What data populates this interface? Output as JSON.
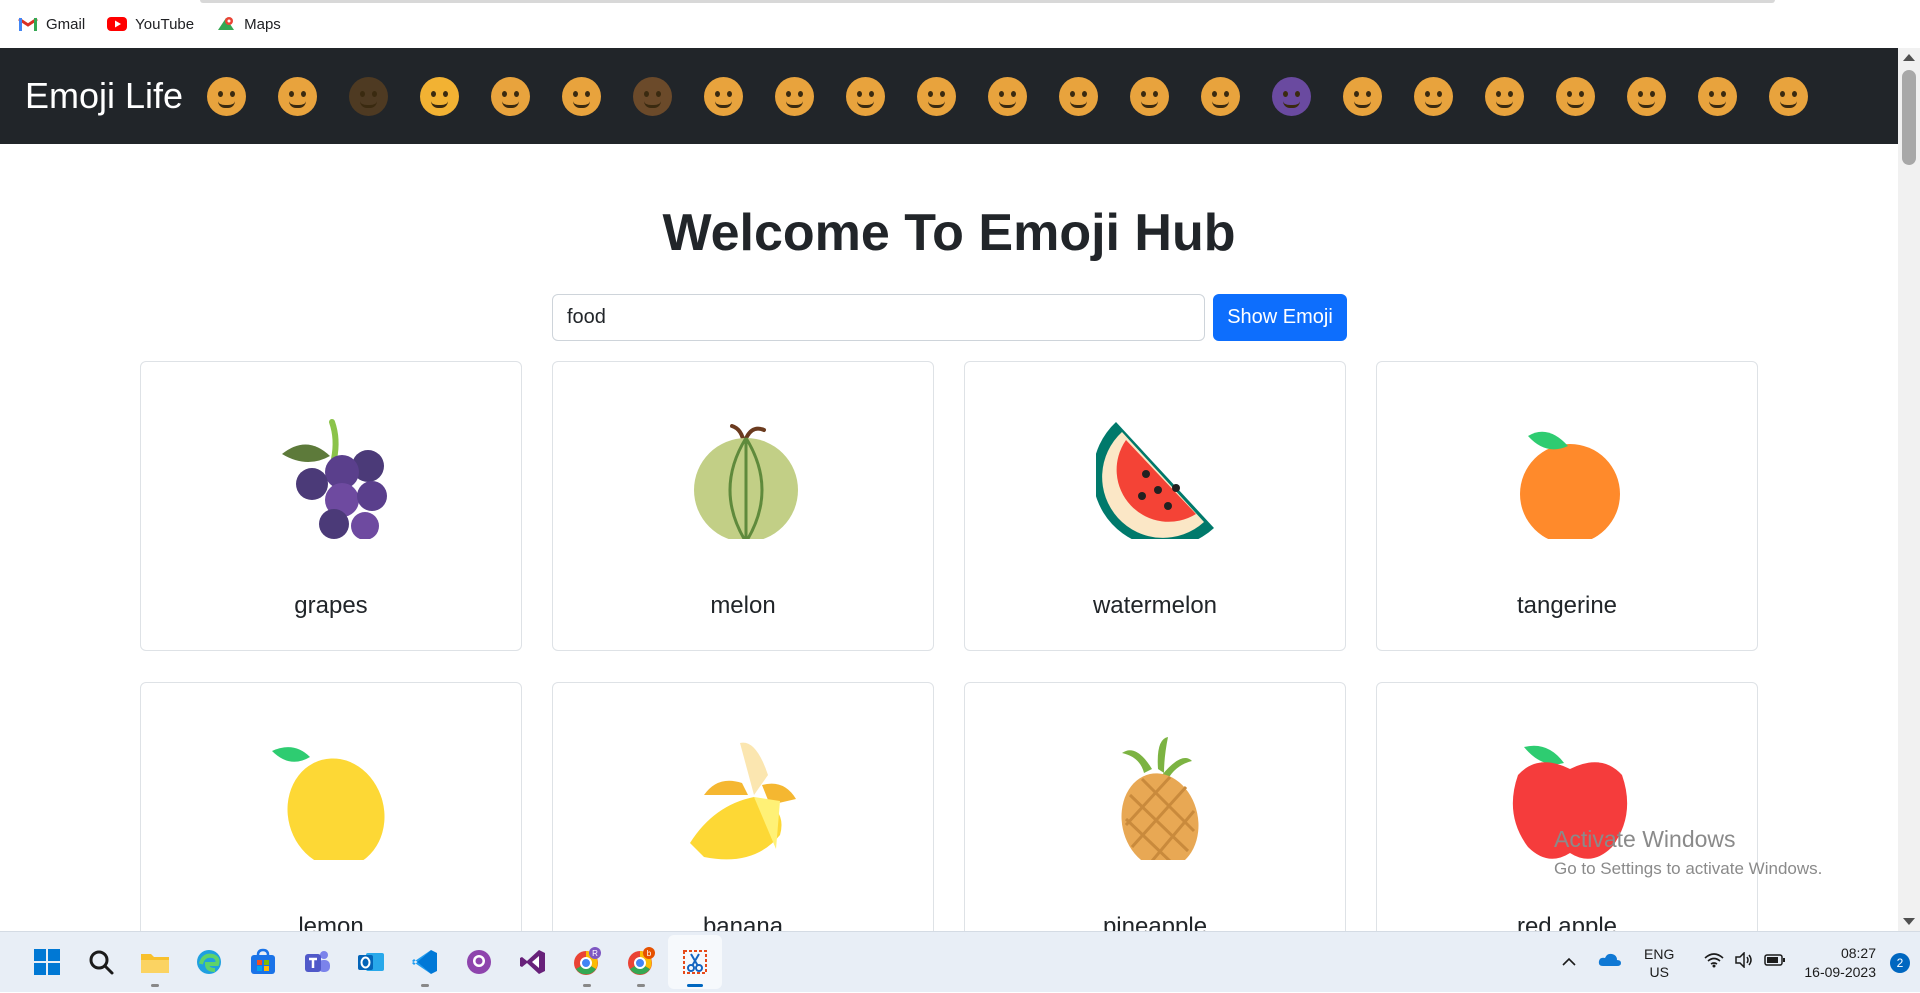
{
  "bookmarks": [
    {
      "label": "Gmail",
      "icon": "gmail-icon"
    },
    {
      "label": "YouTube",
      "icon": "youtube-icon"
    },
    {
      "label": "Maps",
      "icon": "maps-icon"
    }
  ],
  "navbar": {
    "brand": "Emoji Life",
    "emoji_count": 23
  },
  "main": {
    "heading": "Welcome To Emoji Hub",
    "search": {
      "value": "food",
      "button_label": "Show Emoji"
    },
    "cards": [
      {
        "label": "grapes",
        "icon": "grapes-icon"
      },
      {
        "label": "melon",
        "icon": "melon-icon"
      },
      {
        "label": "watermelon",
        "icon": "watermelon-icon"
      },
      {
        "label": "tangerine",
        "icon": "tangerine-icon"
      },
      {
        "label": "lemon",
        "icon": "lemon-icon"
      },
      {
        "label": "banana",
        "icon": "banana-icon"
      },
      {
        "label": "pineapple",
        "icon": "pineapple-icon"
      },
      {
        "label": "red apple",
        "icon": "red-apple-icon"
      }
    ]
  },
  "watermark": {
    "line1": "Activate Windows",
    "line2": "Go to Settings to activate Windows."
  },
  "taskbar": {
    "apps": [
      "start-icon",
      "search-icon",
      "file-explorer-icon",
      "edge-icon",
      "store-icon",
      "teams-icon",
      "outlook-icon",
      "vscode-icon",
      "github-icon",
      "visual-studio-icon",
      "chrome-profile-r-icon",
      "chrome-profile-b-icon",
      "snipping-tool-icon"
    ],
    "lang_line1": "ENG",
    "lang_line2": "US",
    "time": "08:27",
    "date": "16-09-2023",
    "notifications": "2"
  }
}
